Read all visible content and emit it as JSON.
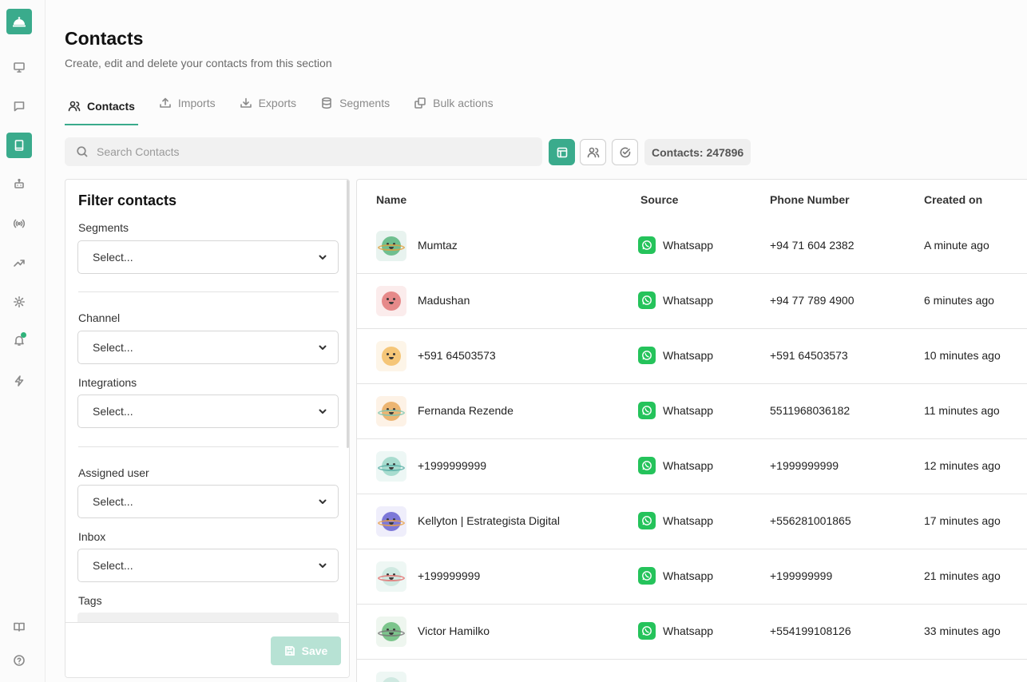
{
  "sidebar": {
    "logo": "bell-logo-icon",
    "items": [
      {
        "name": "monitor-icon"
      },
      {
        "name": "chat-icon"
      },
      {
        "name": "contacts-book-icon",
        "active": true
      },
      {
        "name": "bot-icon"
      },
      {
        "name": "broadcast-icon"
      },
      {
        "name": "trending-up-icon"
      },
      {
        "name": "settings-gear-icon"
      },
      {
        "name": "bell-icon",
        "badge": true
      },
      {
        "name": "lightning-icon"
      }
    ],
    "bottom": [
      {
        "name": "book-open-icon"
      },
      {
        "name": "help-circle-icon"
      }
    ]
  },
  "header": {
    "title": "Contacts",
    "subtitle": "Create, edit and delete your contacts from this section"
  },
  "tabs": [
    {
      "label": "Contacts",
      "icon": "users-icon",
      "active": true
    },
    {
      "label": "Imports",
      "icon": "upload-icon"
    },
    {
      "label": "Exports",
      "icon": "download-icon"
    },
    {
      "label": "Segments",
      "icon": "database-icon"
    },
    {
      "label": "Bulk actions",
      "icon": "copy-icon"
    }
  ],
  "search": {
    "placeholder": "Search Contacts"
  },
  "toolbar": {
    "count_label": "Contacts: 247896"
  },
  "filter": {
    "title": "Filter contacts",
    "fields": [
      {
        "label": "Segments",
        "value": "Select..."
      },
      {
        "label": "Channel",
        "value": "Select..."
      },
      {
        "label": "Integrations",
        "value": "Select..."
      },
      {
        "label": "Assigned user",
        "value": "Select..."
      },
      {
        "label": "Inbox",
        "value": "Select..."
      }
    ],
    "tags_label": "Tags",
    "save_label": "Save"
  },
  "table": {
    "columns": [
      "Name",
      "Source",
      "Phone Number",
      "Created on"
    ],
    "rows": [
      {
        "name": "Mumtaz",
        "source": "Whatsapp",
        "phone": "+94 71 604 2382",
        "created": "A minute ago",
        "avatar_bg": "#e8f3ef",
        "avatar_face": "#6fbf8f",
        "avatar_ring": "#e0a040"
      },
      {
        "name": "Madushan",
        "source": "Whatsapp",
        "phone": "+94 77 789 4900",
        "created": "6 minutes ago",
        "avatar_bg": "#fbecec",
        "avatar_face": "#e68a8a",
        "avatar_ring": ""
      },
      {
        "name": "+591 64503573",
        "source": "Whatsapp",
        "phone": "+591 64503573",
        "created": "10 minutes ago",
        "avatar_bg": "#fdf5e8",
        "avatar_face": "#f5c678",
        "avatar_ring": ""
      },
      {
        "name": "Fernanda Rezende",
        "source": "Whatsapp",
        "phone": "5511968036182",
        "created": "11 minutes ago",
        "avatar_bg": "#fdf2e6",
        "avatar_face": "#ecb572",
        "avatar_ring": "#7fc7b0"
      },
      {
        "name": "+1999999999",
        "source": "Whatsapp",
        "phone": "+1999999999",
        "created": "12 minutes ago",
        "avatar_bg": "#edf7f5",
        "avatar_face": "#a8dccf",
        "avatar_ring": "#5bb0a8"
      },
      {
        "name": "Kellyton | Estrategista Digital",
        "source": "Whatsapp",
        "phone": "+556281001865",
        "created": "17 minutes ago",
        "avatar_bg": "#efeefb",
        "avatar_face": "#7d78d8",
        "avatar_ring": "#e8a04a"
      },
      {
        "name": "+199999999",
        "source": "Whatsapp",
        "phone": "+199999999",
        "created": "21 minutes ago",
        "avatar_bg": "#eef7f4",
        "avatar_face": "#cfe9e1",
        "avatar_ring": "#e27070"
      },
      {
        "name": "Victor Hamilko",
        "source": "Whatsapp",
        "phone": "+554199108126",
        "created": "33 minutes ago",
        "avatar_bg": "#eef6ef",
        "avatar_face": "#7cc58c",
        "avatar_ring": "#777777"
      }
    ]
  }
}
